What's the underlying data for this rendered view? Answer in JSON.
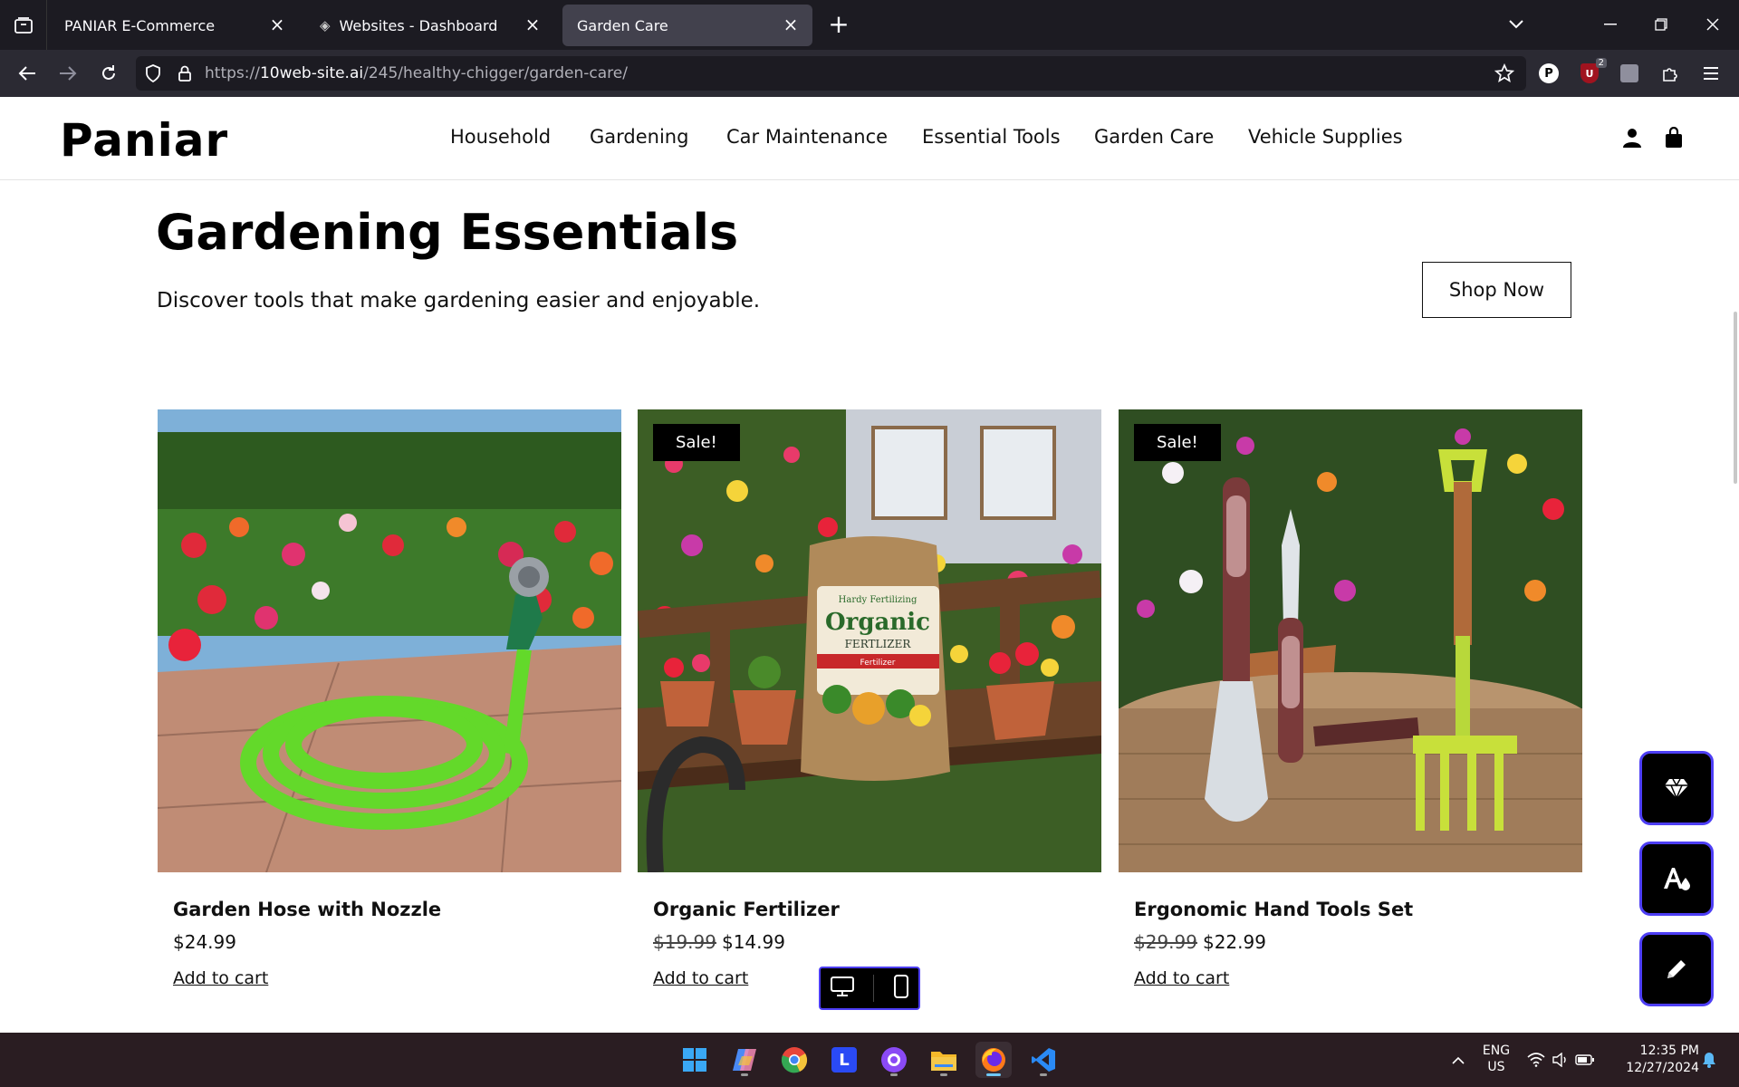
{
  "browser": {
    "tabs": [
      {
        "title": "PANIAR E-Commerce",
        "active": false
      },
      {
        "title": "Websites - Dashboard",
        "active": false
      },
      {
        "title": "Garden Care",
        "active": true
      }
    ],
    "url_prefix": "https://",
    "url_host": "10web-site.ai",
    "url_path": "/245/healthy-chigger/garden-care/",
    "extension_badge": "2"
  },
  "site": {
    "logo": "Paniar",
    "menu": [
      "Household",
      "Gardening",
      "Car Maintenance",
      "Essential Tools",
      "Garden Care",
      "Vehicle Supplies"
    ]
  },
  "section": {
    "title": "Gardening Essentials",
    "subtitle": "Discover tools that make gardening easier and enjoyable.",
    "cta": "Shop Now"
  },
  "products": [
    {
      "name": "Garden Hose with Nozzle",
      "price": "$24.99",
      "old_price": "",
      "sale_badge": "",
      "cart": "Add to cart"
    },
    {
      "name": "Organic Fertilizer",
      "price": "$14.99",
      "old_price": "$19.99",
      "sale_badge": "Sale!",
      "cart": "Add to cart",
      "bag_brand": "Hardy Fertilizing",
      "bag_title": "Organic",
      "bag_sub": "FERTLIZER",
      "bag_label": "Fertilizer"
    },
    {
      "name": "Ergonomic Hand Tools Set",
      "price": "$22.99",
      "old_price": "$29.99",
      "sale_badge": "Sale!",
      "cart": "Add to cart"
    }
  ],
  "taskbar": {
    "lang_top": "ENG",
    "lang_bottom": "US",
    "time": "12:35 PM",
    "date": "12/27/2024",
    "apps": [
      "start-icon",
      "copilot-icon",
      "chrome-icon",
      "l-app-icon",
      "github-desktop-icon",
      "file-explorer-icon",
      "firefox-icon",
      "vscode-icon"
    ]
  },
  "colors": {
    "accent_purple": "#4d3ef5",
    "chrome_bg": "#1c1b22",
    "toolbar_bg": "#2b2a33"
  }
}
